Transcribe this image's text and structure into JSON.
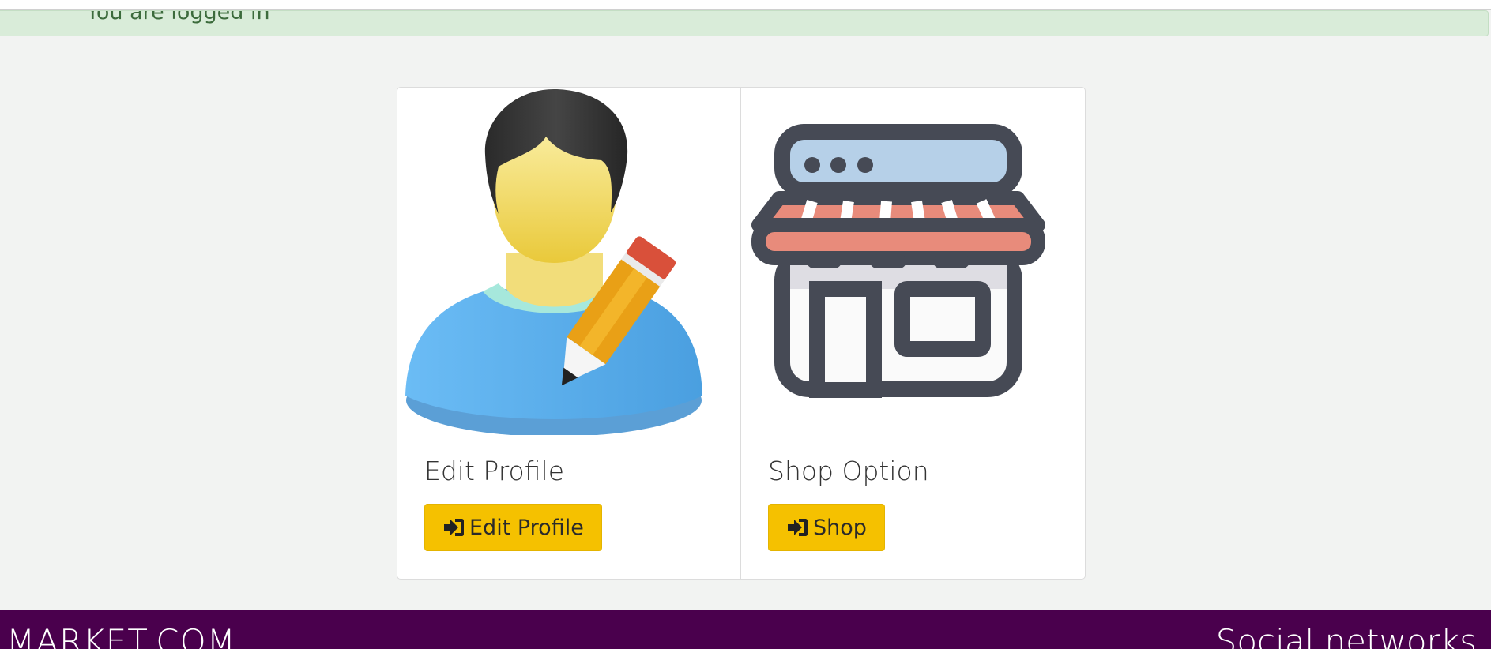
{
  "alert": {
    "text": "You are logged in"
  },
  "cards": [
    {
      "title": "Edit Profile",
      "button_label": "Edit Profile",
      "icon": "user-edit-icon"
    },
    {
      "title": "Shop Option",
      "button_label": "Shop",
      "icon": "shop-icon"
    }
  ],
  "footer": {
    "brand": "MARKET.COM",
    "social_heading": "Social networks"
  },
  "colors": {
    "button": "#f5c100",
    "footer": "#4a004d",
    "alert": "#d9ecd9"
  }
}
